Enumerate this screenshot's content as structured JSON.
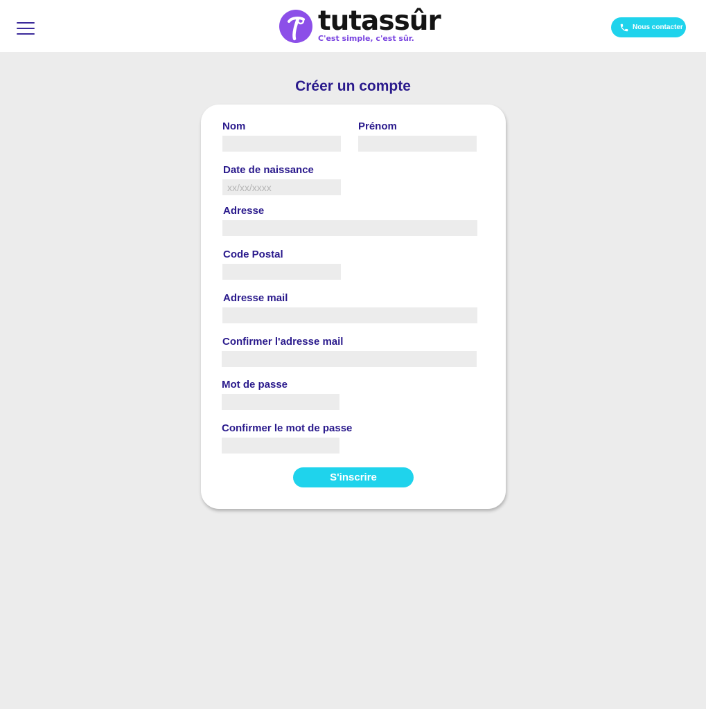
{
  "header": {
    "menu_icon": "hamburger-menu-icon",
    "brand_name": "tutassûr",
    "tagline": "C'est simple, c'est sûr.",
    "logo_icon": "tutassur-logo-icon",
    "contact_button_label": "Nous contacter",
    "contact_icon": "phone-icon"
  },
  "form": {
    "title": "Créer un compte",
    "fields": {
      "nom": {
        "label": "Nom",
        "value": ""
      },
      "prenom": {
        "label": "Prénom",
        "value": ""
      },
      "date_naissance": {
        "label": "Date de naissance",
        "value": "",
        "placeholder": "xx/xx/xxxx"
      },
      "adresse": {
        "label": "Adresse",
        "value": ""
      },
      "code_postal": {
        "label": "Code Postal",
        "value": ""
      },
      "adresse_mail": {
        "label": "Adresse mail",
        "value": ""
      },
      "confirmer_mail": {
        "label": "Confirmer l'adresse mail",
        "value": ""
      },
      "mot_de_passe": {
        "label": "Mot de passe",
        "value": ""
      },
      "confirmer_mdp": {
        "label": "Confirmer le mot de passe",
        "value": ""
      }
    },
    "submit_label": "S'inscrire"
  },
  "colors": {
    "brand_purple": "#7a45e0",
    "label_navy": "#2a1a8c",
    "accent_cyan": "#1fd3ec",
    "background": "#ececec",
    "input_fill": "#ececec"
  }
}
